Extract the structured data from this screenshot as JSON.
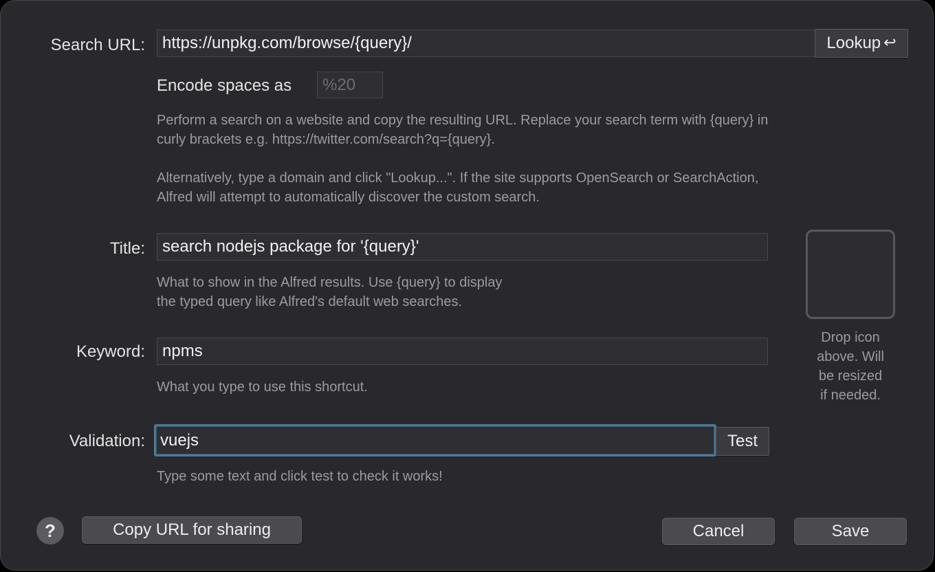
{
  "search_url": {
    "label": "Search URL:",
    "value": "https://unpkg.com/browse/{query}/",
    "lookup_label": "Lookup",
    "lookup_icon": "↩"
  },
  "encode": {
    "label": "Encode spaces as",
    "placeholder": "%20"
  },
  "search_help": {
    "line1": "Perform a search on a website and copy the resulting URL. Replace your search term with {query} in",
    "line2": "curly brackets e.g. https://twitter.com/search?q={query}.",
    "line3": "Alternatively, type a domain and click \"Lookup...\". If the site supports OpenSearch or SearchAction,",
    "line4": "Alfred will attempt to automatically discover the custom search."
  },
  "title": {
    "label": "Title:",
    "value": "search nodejs package for '{query}'",
    "help1": "What to show in the Alfred results. Use {query} to display",
    "help2": "the typed query like Alfred's default web searches."
  },
  "keyword": {
    "label": "Keyword:",
    "value": "npms",
    "help": "What you type to use this shortcut."
  },
  "validation": {
    "label": "Validation:",
    "value": "vuejs",
    "test_label": "Test",
    "help": "Type some text and click test to check it works!"
  },
  "icon_drop": {
    "line1": "Drop icon",
    "line2": "above. Will",
    "line3": "be resized",
    "line4": "if needed."
  },
  "footer": {
    "help_glyph": "?",
    "copy_url_label": "Copy URL for sharing",
    "cancel_label": "Cancel",
    "save_label": "Save"
  },
  "colors": {
    "background": "#29282c",
    "focus_ring": "#4d7a98"
  }
}
